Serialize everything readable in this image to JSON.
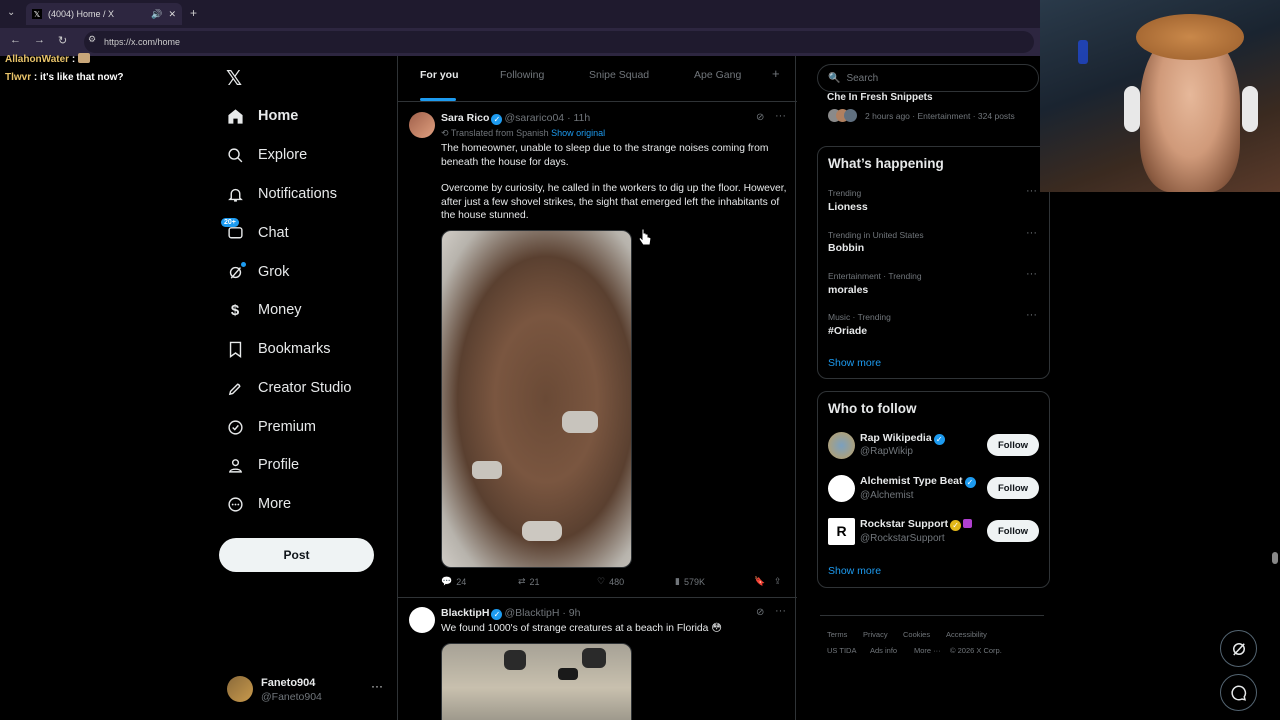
{
  "browser": {
    "tab_title": "(4004) Home / X",
    "url": "https://x.com/home"
  },
  "chat_overlay": [
    {
      "name": "AllahonWater",
      "message": ":"
    },
    {
      "name": "Tlwvr",
      "message": ": it's like that now?"
    }
  ],
  "nav": {
    "items": [
      {
        "label": "Home",
        "icon": "home-icon"
      },
      {
        "label": "Explore",
        "icon": "search-icon"
      },
      {
        "label": "Notifications",
        "icon": "bell-icon"
      },
      {
        "label": "Chat",
        "icon": "chat-icon",
        "badge": "20+"
      },
      {
        "label": "Grok",
        "icon": "grok-icon"
      },
      {
        "label": "Money",
        "icon": "dollar-icon"
      },
      {
        "label": "Bookmarks",
        "icon": "bookmark-icon"
      },
      {
        "label": "Creator Studio",
        "icon": "rocket-icon"
      },
      {
        "label": "Premium",
        "icon": "verified-icon"
      },
      {
        "label": "Profile",
        "icon": "person-icon"
      },
      {
        "label": "More",
        "icon": "more-circle-icon"
      }
    ],
    "post_label": "Post",
    "account": {
      "name": "Faneto904",
      "handle": "@Faneto904"
    }
  },
  "feed": {
    "tabs": [
      "For you",
      "Following",
      "Snipe Squad",
      "Ape Gang"
    ],
    "posts": [
      {
        "name": "Sara Rico",
        "handle": "@sararico04",
        "time": "· 11h",
        "translated": "Translated from Spanish",
        "show_original": "Show original",
        "text1": "The homeowner, unable to sleep due to the strange noises coming from beneath the house for days.",
        "text2": "Overcome by curiosity, he called in the workers to dig up the floor. However, after just a few shovel strikes, the sight that emerged left the inhabitants of the house stunned.",
        "replies": "24",
        "reposts": "21",
        "likes": "480",
        "views": "579K"
      },
      {
        "name": "BlacktipH",
        "handle": "@BlacktipH",
        "time": "· 9h",
        "text": "We found 1000's of strange creatures at a beach in Florida 😳"
      }
    ]
  },
  "sidebar": {
    "search_placeholder": "Search",
    "top_snippet": {
      "title": "Che In Fresh Snippets",
      "meta": "2 hours ago · Entertainment · 324 posts"
    },
    "whats_happening": {
      "title": "What’s happening",
      "trends": [
        {
          "meta": "Trending",
          "name": "Lioness"
        },
        {
          "meta": "Trending in United States",
          "name": "Bobbin"
        },
        {
          "meta": "Entertainment · Trending",
          "name": "morales"
        },
        {
          "meta": "Music · Trending",
          "name": "#Oriade"
        }
      ],
      "show_more": "Show more"
    },
    "who_to_follow": {
      "title": "Who to follow",
      "accounts": [
        {
          "name": "Rap Wikipedia",
          "handle": "@RapWikip"
        },
        {
          "name": "Alchemist Type Beat",
          "handle": "@Alchemist"
        },
        {
          "name": "Rockstar Support",
          "handle": "@RockstarSupport"
        }
      ],
      "follow_label": "Follow",
      "show_more": "Show more"
    },
    "footer": {
      "row1": [
        "Terms",
        "Privacy",
        "Cookies",
        "Accessibility"
      ],
      "row2": [
        "US TIDA",
        "Ads info",
        "More ···",
        "© 2026 X Corp."
      ]
    }
  }
}
